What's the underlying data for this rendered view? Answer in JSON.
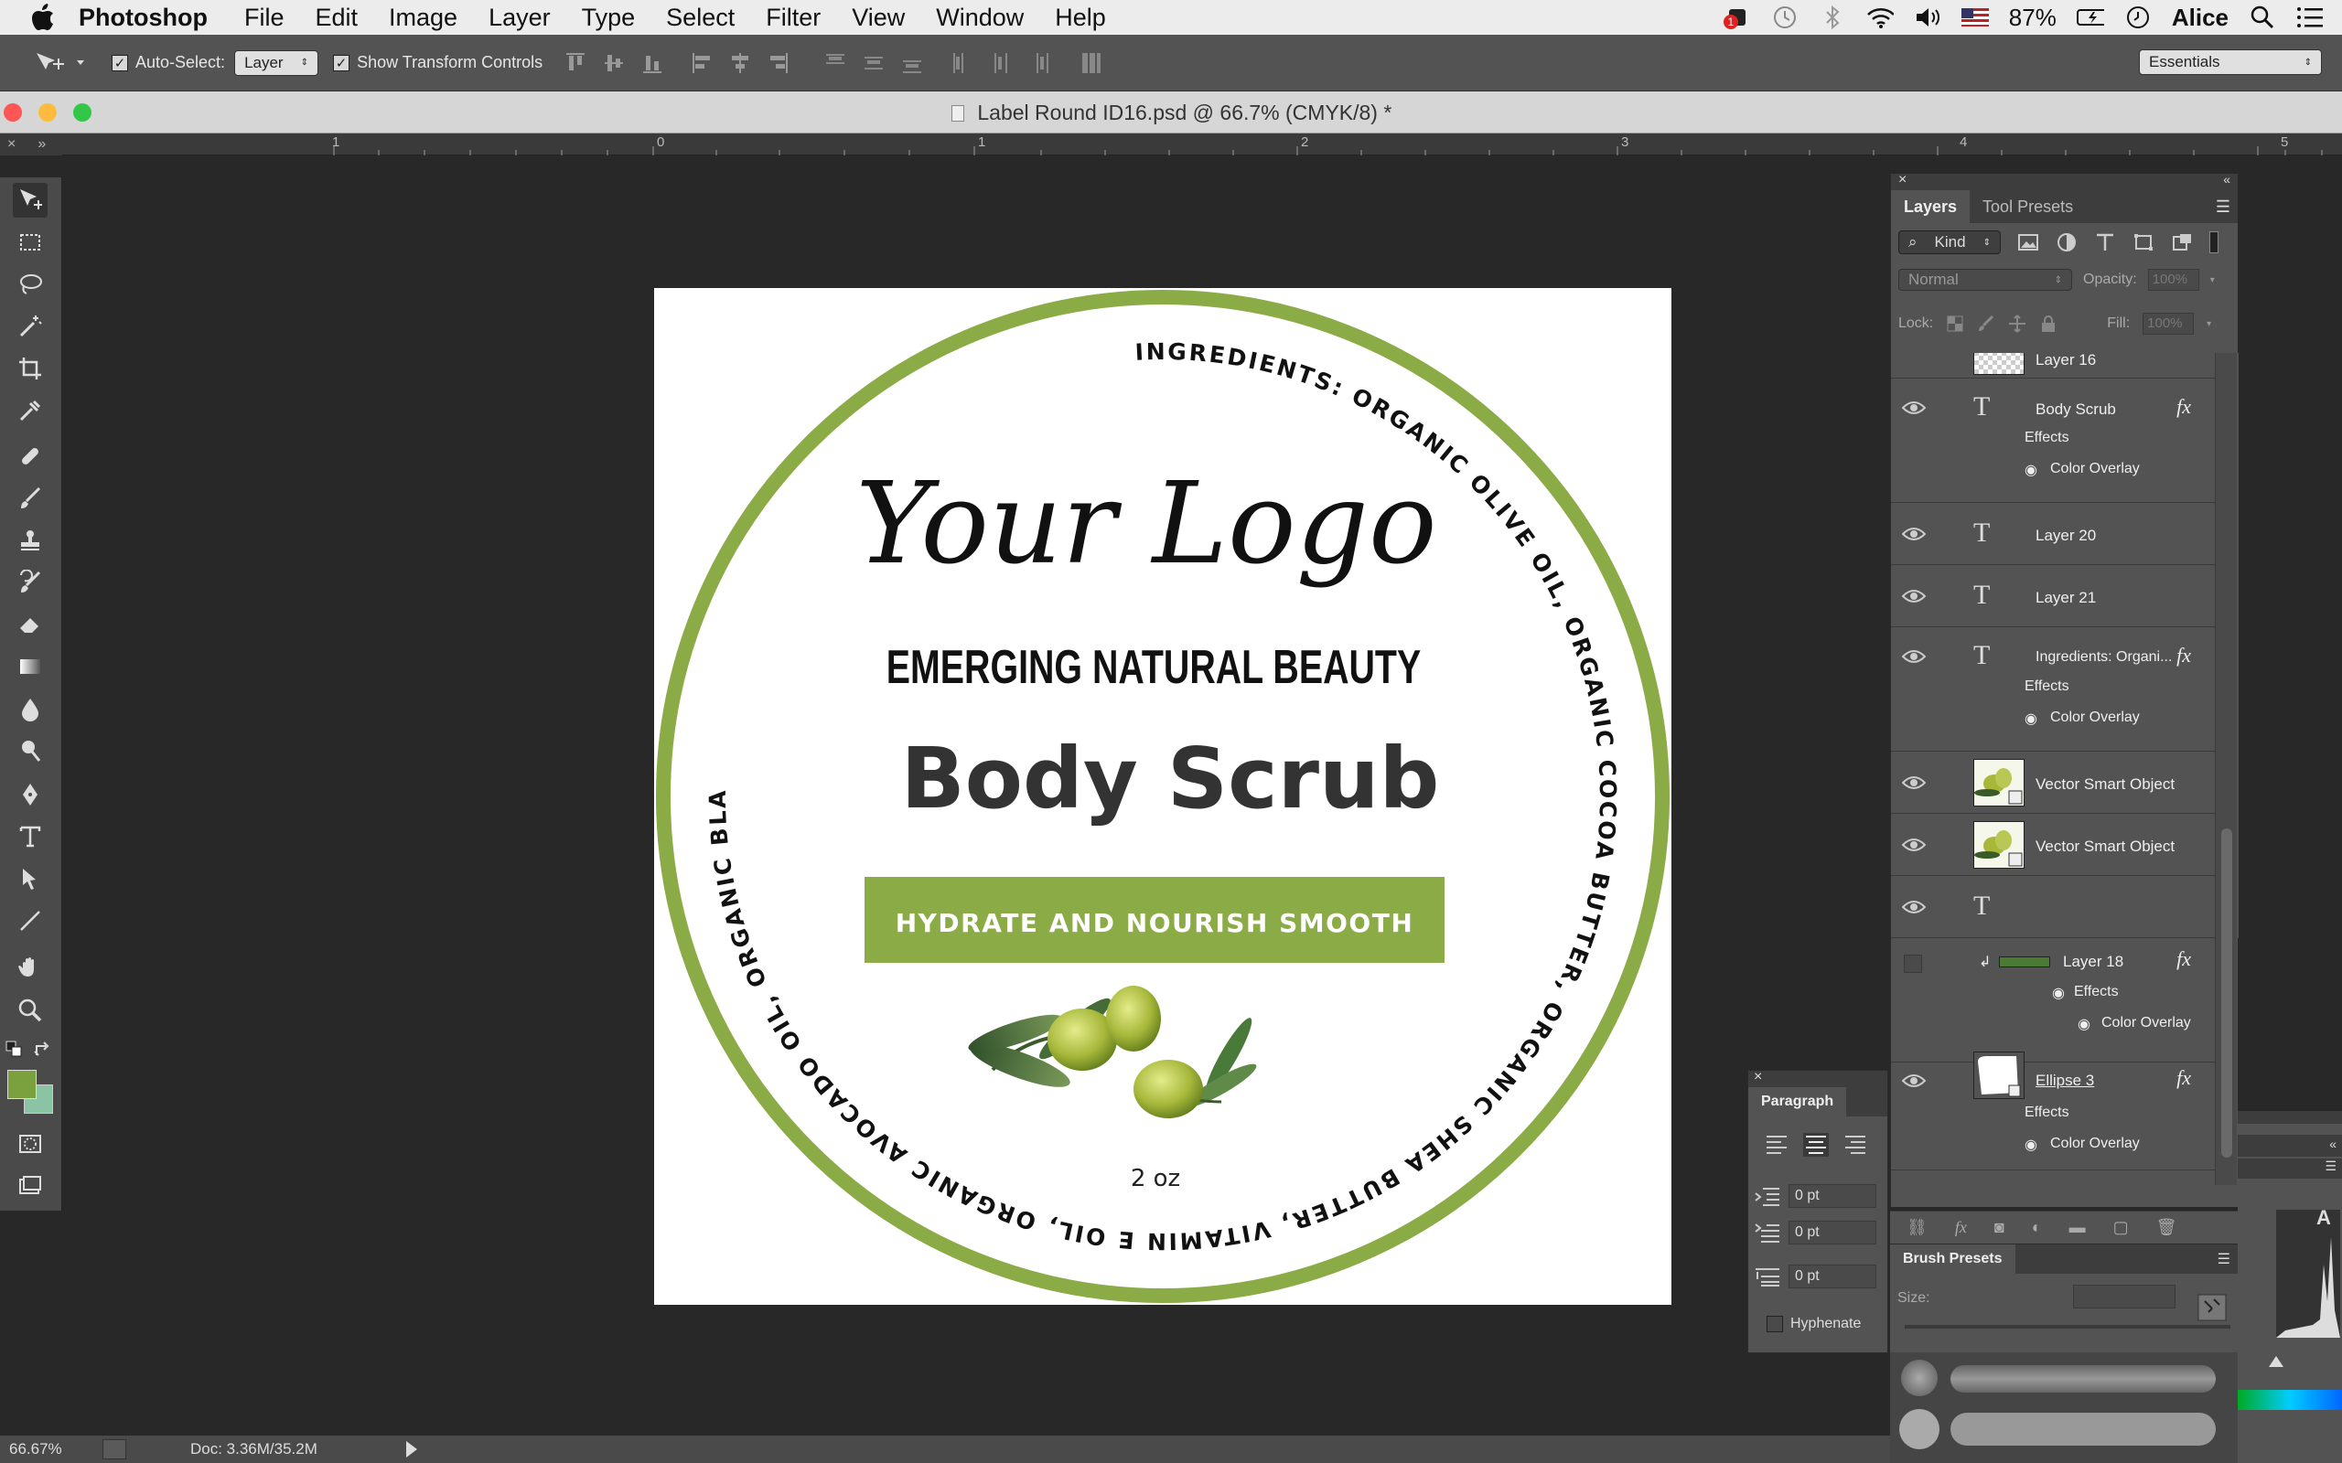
{
  "menubar": {
    "app": "Photoshop",
    "items": [
      "File",
      "Edit",
      "Image",
      "Layer",
      "Type",
      "Select",
      "Filter",
      "View",
      "Window",
      "Help"
    ],
    "battery": "87%",
    "user": "Alice",
    "notification_count": "1"
  },
  "options": {
    "auto_select_label": "Auto-Select:",
    "auto_select_value": "Layer",
    "transform_label": "Show Transform Controls",
    "workspace": "Essentials"
  },
  "document": {
    "title": "Label Round ID16.psd @ 66.7% (CMYK/8) *"
  },
  "ruler": {
    "ticks": [
      "1",
      "0",
      "1",
      "2",
      "3",
      "4",
      "5"
    ]
  },
  "label": {
    "ring_text": "INGREDIENTS: ORGANIC OLIVE OIL, ORGANIC COCOA BUTTER, ORGANIC SHEA BUTTER, VITAMIN E OIL, ORGANIC AVOCADO OIL, ORGANIC BLACK CASTOR OIL,ORGANIC COCOA BUTTER, ORGANIC SHEA BUTTER, VITAMIN E OIL,",
    "logo": "Your Logo",
    "brand": "EMERGING NATURAL BEAUTY",
    "product": "Body Scrub",
    "banner": "HYDRATE AND NOURISH SMOOTH",
    "size": "2 oz",
    "accent": "#8aab45"
  },
  "layers": {
    "tabs": [
      "Layers",
      "Tool Presets"
    ],
    "kind": "Kind",
    "blend": "Normal",
    "opacity_label": "Opacity:",
    "opacity": "100%",
    "lock_label": "Lock:",
    "fill_label": "Fill:",
    "fill": "100%",
    "effects_label": "Effects",
    "overlay_label": "Color Overlay",
    "items": [
      {
        "name": "Layer 16"
      },
      {
        "name": "Body Scrub"
      },
      {
        "name": "Layer 20"
      },
      {
        "name": "Layer 21"
      },
      {
        "name": "Ingredients: Organi..."
      },
      {
        "name": "Vector Smart Object"
      },
      {
        "name": "Vector Smart Object"
      },
      {
        "name": ""
      },
      {
        "name": "Layer 18"
      },
      {
        "name": "Ellipse 3"
      }
    ]
  },
  "paragraph": {
    "title": "Paragraph",
    "indent_left": "0 pt",
    "indent_first": "0 pt",
    "space_before": "0 pt",
    "hyphenate": "Hyphenate"
  },
  "brush": {
    "title": "Brush Presets",
    "size_label": "Size:"
  },
  "status": {
    "zoom": "66.67%",
    "doc": "Doc: 3.36M/35.2M"
  }
}
